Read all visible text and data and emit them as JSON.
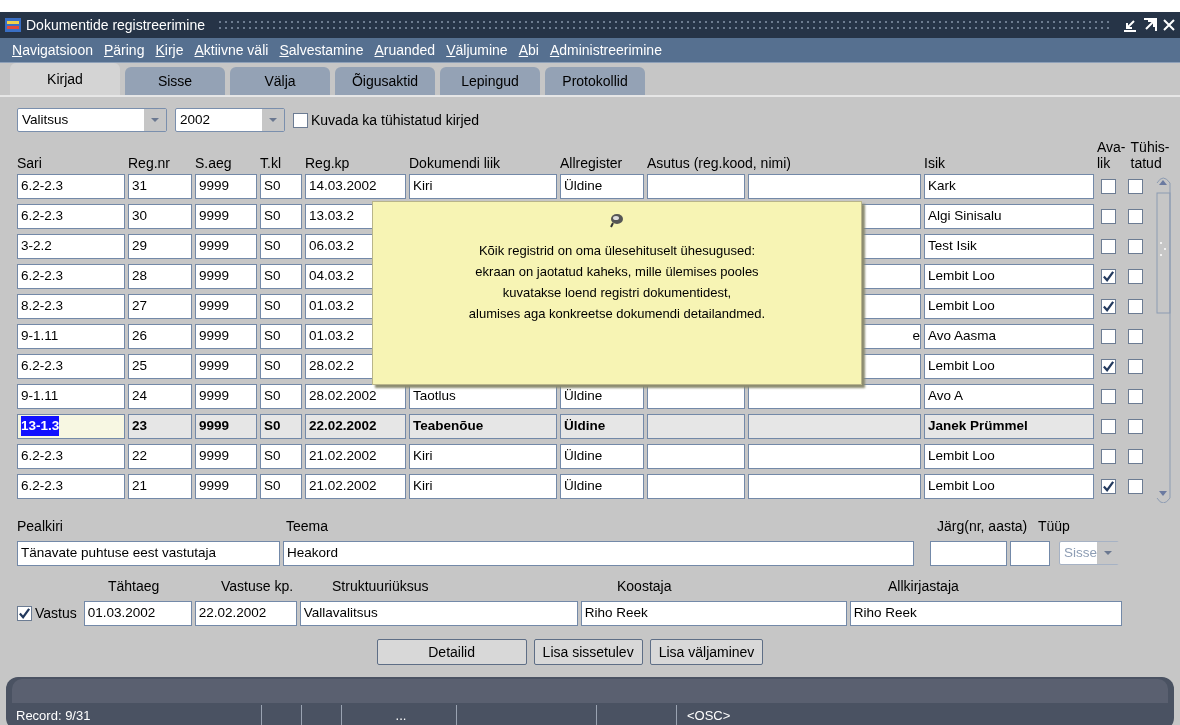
{
  "window": {
    "title": "Dokumentide registreerimine"
  },
  "menu": [
    {
      "label": "Navigatsioon"
    },
    {
      "label": "Päring"
    },
    {
      "label": "Kirje"
    },
    {
      "label": "Aktiivne väli"
    },
    {
      "label": "Salvestamine"
    },
    {
      "label": "Aruanded"
    },
    {
      "label": "Väljumine"
    },
    {
      "label": "Abi"
    },
    {
      "label": "Administreerimine"
    }
  ],
  "tabs": [
    {
      "label": "Kirjad",
      "selected": true
    },
    {
      "label": "Sisse",
      "selected": false
    },
    {
      "label": "Välja",
      "selected": false
    },
    {
      "label": "Õigusaktid",
      "selected": false
    },
    {
      "label": "Lepingud",
      "selected": false
    },
    {
      "label": "Protokollid",
      "selected": false
    }
  ],
  "filters": {
    "register": "Valitsus",
    "year": "2002",
    "show_cancelled": {
      "label": "Kuvada ka tühistatud kirjed",
      "checked": false
    }
  },
  "table": {
    "columns": [
      {
        "label": "Sari"
      },
      {
        "label": "Reg.nr"
      },
      {
        "label": "S.aeg"
      },
      {
        "label": "T.kl"
      },
      {
        "label": "Reg.kp"
      },
      {
        "label": "Dokumendi liik"
      },
      {
        "label": "Allregister"
      },
      {
        "label": "Asutus (reg.kood, nimi)"
      },
      {
        "kind": "unlabeled"
      },
      {
        "label": "Isik"
      },
      {
        "lines": [
          "Ava-",
          "lik"
        ]
      },
      {
        "lines": [
          "Tühis-",
          "tatud"
        ]
      }
    ],
    "rows": [
      {
        "cells": [
          "6.2-2.3",
          "31",
          "9999",
          "S0",
          "14.03.2002",
          "Kiri",
          "Üldine",
          "",
          "",
          "Kark"
        ],
        "avalik": false,
        "tuhistatud": false,
        "selected": false
      },
      {
        "cells": [
          "6.2-2.3",
          "30",
          "9999",
          "S0",
          "13.03.2",
          null,
          null,
          null,
          "",
          "Algi Sinisalu"
        ],
        "avalik": false,
        "tuhistatud": false,
        "selected": false
      },
      {
        "cells": [
          "3-2.2",
          "29",
          "9999",
          "S0",
          "06.03.2",
          null,
          null,
          null,
          "",
          "Test Isik"
        ],
        "avalik": false,
        "tuhistatud": false,
        "selected": false
      },
      {
        "cells": [
          "6.2-2.3",
          "28",
          "9999",
          "S0",
          "04.03.2",
          null,
          null,
          null,
          "",
          "Lembit Loo"
        ],
        "avalik": true,
        "tuhistatud": false,
        "selected": false
      },
      {
        "cells": [
          "8.2-2.3",
          "27",
          "9999",
          "S0",
          "01.03.2",
          null,
          null,
          null,
          "",
          "Lembit Loo"
        ],
        "avalik": true,
        "tuhistatud": false,
        "selected": false
      },
      {
        "cells": [
          "9-1.11",
          "26",
          "9999",
          "S0",
          "01.03.2",
          null,
          null,
          null,
          "e",
          "Avo Aasma"
        ],
        "avalik": false,
        "tuhistatud": false,
        "selected": false
      },
      {
        "cells": [
          "6.2-2.3",
          "25",
          "9999",
          "S0",
          "28.02.2",
          null,
          null,
          null,
          "",
          "Lembit Loo"
        ],
        "avalik": true,
        "tuhistatud": false,
        "selected": false
      },
      {
        "cells": [
          "9-1.11",
          "24",
          "9999",
          "S0",
          "28.02.2002",
          "Taotlus",
          "Üldine",
          "",
          "",
          "Avo A"
        ],
        "avalik": false,
        "tuhistatud": false,
        "selected": false
      },
      {
        "cells": [
          "13-1.3",
          "23",
          "9999",
          "S0",
          "22.02.2002",
          "Teabenõue",
          "Üldine",
          "",
          "",
          "Janek Prümmel"
        ],
        "avalik": false,
        "tuhistatud": false,
        "selected": true
      },
      {
        "cells": [
          "6.2-2.3",
          "22",
          "9999",
          "S0",
          "21.02.2002",
          "Kiri",
          "Üldine",
          "",
          "",
          "Lembit Loo"
        ],
        "avalik": false,
        "tuhistatud": false,
        "selected": false
      },
      {
        "cells": [
          "6.2-2.3",
          "21",
          "9999",
          "S0",
          "21.02.2002",
          "Kiri",
          "Üldine",
          "",
          "",
          "Lembit Loo"
        ],
        "avalik": true,
        "tuhistatud": false,
        "selected": false
      }
    ]
  },
  "tooltip": {
    "lines": [
      "Kõik registrid on oma ülesehituselt ühesugused:",
      "ekraan on jaotatud kaheks, mille ülemises pooles",
      "kuvatakse loend registri dokumentidest,",
      "alumises aga konkreetse dokumendi detailandmed."
    ]
  },
  "detail": {
    "pealkiri": {
      "label": "Pealkiri",
      "value": "Tänavate puhtuse eest vastutaja"
    },
    "teema": {
      "label": "Teema",
      "value": "Heakord"
    },
    "jarg": {
      "label": "Järg(nr, aasta)"
    },
    "tuup": {
      "label": "Tüüp",
      "value": "Sisse",
      "disabled": true
    },
    "vastus": {
      "label": "Vastus",
      "checked": true
    },
    "tahtaeg": {
      "label": "Tähtaeg",
      "value": "01.03.2002"
    },
    "vastuse_kp": {
      "label": "Vastuse kp.",
      "value": "22.02.2002"
    },
    "struktuuriuksus": {
      "label": "Struktuuriüksus",
      "value": "Vallavalitsus"
    },
    "koostaja": {
      "label": "Koostaja",
      "value": "Riho Reek"
    },
    "allkirjastaja": {
      "label": "Allkirjastaja",
      "value": "Riho Reek"
    }
  },
  "buttons": [
    {
      "label": "Detailid"
    },
    {
      "label": "Lisa sissetulev"
    },
    {
      "label": "Lisa väljaminev"
    }
  ],
  "status_bar": {
    "record": "Record: 9/31",
    "ellipsis": "...",
    "mode": "<OSC>"
  }
}
